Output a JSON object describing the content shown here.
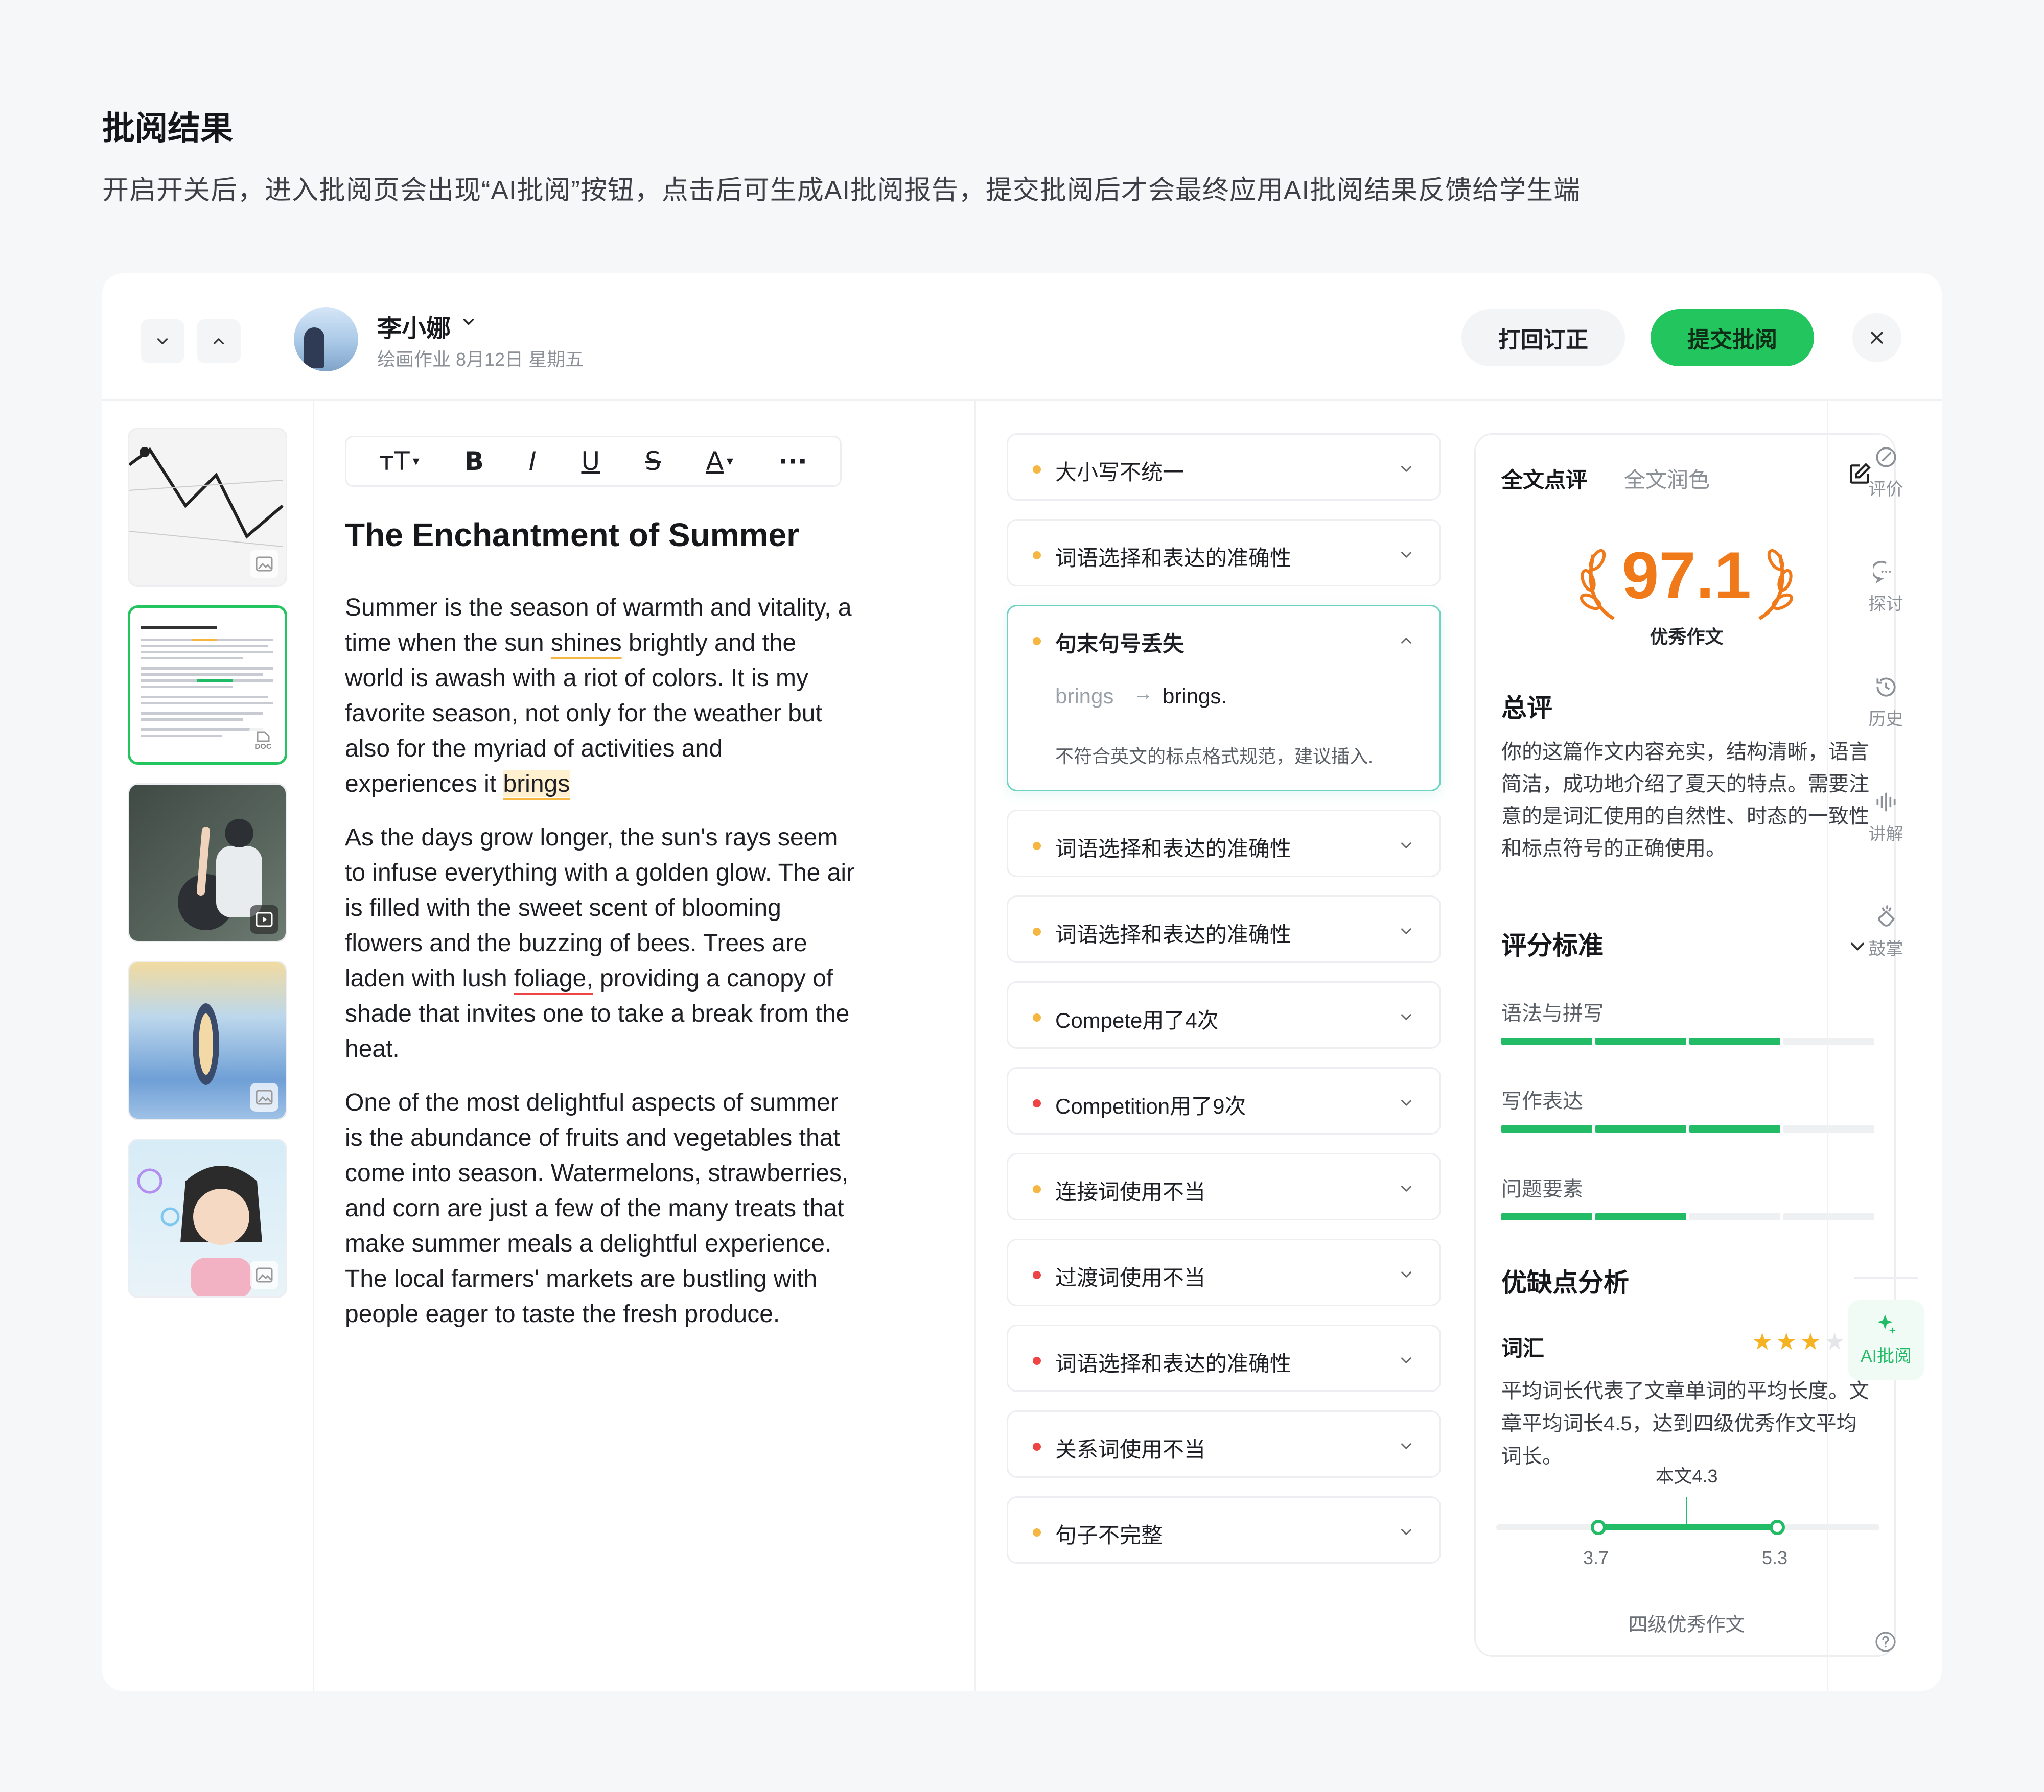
{
  "header": {
    "title": "批阅结果",
    "description": "开启开关后，进入批阅页会出现“AI批阅”按钮，点击后可生成AI批阅报告，提交批阅后才会最终应用AI批阅结果反馈给学生端"
  },
  "student": {
    "name": "李小娜",
    "meta": "绘画作业 8月12日 星期五"
  },
  "actions": {
    "return_label": "打回订正",
    "submit_label": "提交批阅"
  },
  "colors": {
    "brand_green": "#22c55e",
    "score_orange": "#f07a1a",
    "warn_yellow": "#f5b642",
    "error_red": "#ef4444"
  },
  "thumbnails": [
    {
      "kind": "image",
      "icon": "image-icon"
    },
    {
      "kind": "doc",
      "icon": "doc-icon",
      "badge": "DOC",
      "active": true
    },
    {
      "kind": "video",
      "icon": "play-icon"
    },
    {
      "kind": "image",
      "icon": "image-icon"
    },
    {
      "kind": "image",
      "icon": "image-icon"
    }
  ],
  "toolbar": {
    "text_size": "тT",
    "bold": "B",
    "italic": "I",
    "underline": "U",
    "strike": "S",
    "color": "A",
    "more": "···"
  },
  "essay": {
    "title": "The Enchantment of Summer",
    "p1_a": "Summer is the season of warmth and vitality, a time when the sun ",
    "p1_w1": "shines",
    "p1_b": " brightly and the world is awash with a riot of colors. It is my favorite season, not only for the weather but also for the myriad of activities and experiences it ",
    "p1_w2": "brings",
    "p2_a": "As the days grow longer, the sun's rays seem to infuse everything with a golden glow. The air is filled with the sweet scent of blooming flowers and the buzzing of bees. Trees are laden with lush ",
    "p2_w1": "foliage,",
    "p2_b": " providing a canopy of shade that invites one to take a break from the heat.",
    "p3": "One of the most delightful aspects of summer is the abundance of fruits and vegetables that come into season. Watermelons, strawberries, and corn are just a few of the many treats that make summer meals a delightful experience. The local farmers' markets are bustling with people eager to taste the fresh produce."
  },
  "issues": [
    {
      "label": "大小写不统一",
      "severity": "warning"
    },
    {
      "label": "词语选择和表达的准确性",
      "severity": "warning"
    },
    {
      "label": "句末句号丢失",
      "severity": "warning",
      "expanded": true,
      "original": "brings",
      "suggestion": "brings.",
      "explanation": "不符合英文的标点格式规范，建议插入."
    },
    {
      "label": "词语选择和表达的准确性",
      "severity": "warning"
    },
    {
      "label": "词语选择和表达的准确性",
      "severity": "warning"
    },
    {
      "label": "Compete用了4次",
      "severity": "warning"
    },
    {
      "label": "Competition用了9次",
      "severity": "error"
    },
    {
      "label": "连接词使用不当",
      "severity": "warning"
    },
    {
      "label": "过渡词使用不当",
      "severity": "error"
    },
    {
      "label": "词语选择和表达的准确性",
      "severity": "error"
    },
    {
      "label": "关系词使用不当",
      "severity": "error"
    },
    {
      "label": "句子不完整",
      "severity": "warning"
    }
  ],
  "report": {
    "tabs": [
      "全文点评",
      "全文润色"
    ],
    "score": "97.1",
    "score_tag": "优秀作文",
    "summary_title": "总评",
    "summary": "你的这篇作文内容充实，结构清晰，语言简洁，成功地介绍了夏天的特点。需要注意的是词汇使用的自然性、时态的一致性和标点符号的正确使用。",
    "criteria_title": "评分标准",
    "criteria": [
      {
        "label": "语法与拼写",
        "level": 0.75
      },
      {
        "label": "写作表达",
        "level": 0.75
      },
      {
        "label": "问题要素",
        "level": 0.5
      }
    ],
    "analysis_title": "优缺点分析",
    "vocab": {
      "title": "词汇",
      "stars": 3,
      "max_stars": 5,
      "text": "平均词长代表了文章单词的平均长度。文章平均词长4.5，达到四级优秀作文平均词长。",
      "current_label": "本文4.3",
      "current": 4.3,
      "range_min": "3.7",
      "range_max": "5.3",
      "range_caption": "四级优秀作文"
    }
  },
  "rail": [
    {
      "label": "评价",
      "icon": "evaluate-icon"
    },
    {
      "label": "探讨",
      "icon": "discuss-icon"
    },
    {
      "label": "历史",
      "icon": "history-icon"
    },
    {
      "label": "讲解",
      "icon": "voice-icon"
    },
    {
      "label": "鼓掌",
      "icon": "clap-icon"
    },
    {
      "label": "AI批阅",
      "icon": "ai-sparkle-icon",
      "active": true
    }
  ]
}
